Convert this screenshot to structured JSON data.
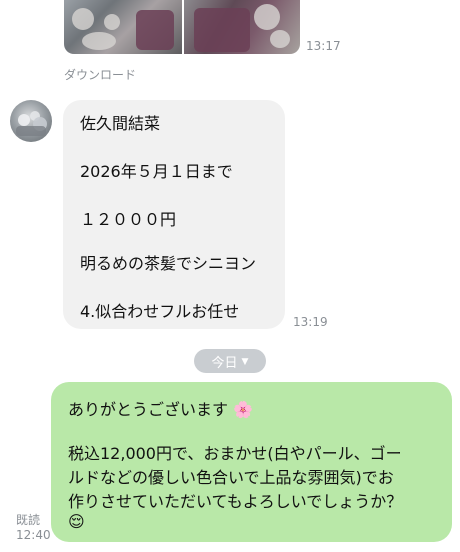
{
  "chat": {
    "photos": {
      "time": "13:17",
      "download_label": "ダウンロード"
    },
    "incoming": {
      "lines": [
        "佐久間結菜",
        "2026年５月１日まで",
        "１２０００円",
        "明るめの茶髪でシニヨン",
        "4.似合わせフルお任せ"
      ],
      "time": "13:19"
    },
    "date_divider": {
      "label": "今日",
      "icon": "chevron-down-icon"
    },
    "outgoing": {
      "line1": "ありがとうございます",
      "line1_emoji": "🌸",
      "line2": "税込12,000円で、おまかせ(白やパール、ゴー",
      "line3": "ルドなどの優しい色合いで上品な雰囲気)でお",
      "line4": "作りさせていただいてもよろしいでしょうか？",
      "emoji": "😌",
      "read_label": "既読",
      "time": "12:40"
    }
  },
  "colors": {
    "incoming_bubble": "#f1f1f1",
    "outgoing_bubble": "#b9e8a8",
    "date_chip": "#c9cdd1",
    "meta_text": "#8a8f95"
  }
}
